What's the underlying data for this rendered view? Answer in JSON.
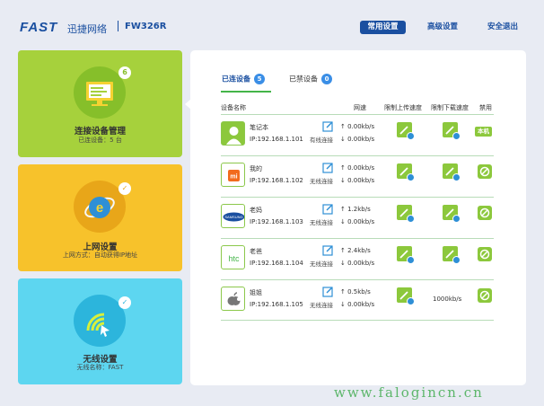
{
  "header": {
    "logo": "FAST",
    "brand": "迅捷网络",
    "model": "FW326R",
    "nav": [
      "常用设置",
      "高级设置",
      "安全退出"
    ]
  },
  "cards": [
    {
      "title": "连接设备管理",
      "sub": "已连设备：5 台",
      "badge": "6",
      "color": "#a6d13c",
      "icon": "monitor-icon"
    },
    {
      "title": "上网设置",
      "sub": "上网方式：自动获得IP地址",
      "badge": "✓",
      "color": "#f7c22b",
      "icon": "internet-explorer-icon"
    },
    {
      "title": "无线设置",
      "sub": "无线名称：FAST",
      "badge": "✓",
      "color": "#5dd6f0",
      "icon": "wifi-icon"
    }
  ],
  "tabs": {
    "connected_label": "已连设备",
    "connected_count": "5",
    "banned_label": "已禁设备",
    "banned_count": "0"
  },
  "table": {
    "headers": [
      "设备名称",
      "网速",
      "限制上传速度",
      "限制下载速度",
      "禁用"
    ],
    "rows": [
      {
        "name": "笔记本",
        "ip": "IP:192.168.1.101",
        "conn": "有线连接",
        "up": "↑ 0.00kb/s",
        "down": "↓ 0.00kb/s",
        "avatar": "person",
        "local": "本机"
      },
      {
        "name": "我的",
        "ip": "IP:192.168.1.102",
        "conn": "无线连接",
        "up": "↑ 0.00kb/s",
        "down": "↓ 0.00kb/s",
        "avatar": "mi"
      },
      {
        "name": "老妈",
        "ip": "IP:192.168.1.103",
        "conn": "无线连接",
        "up": "↑ 1.2kb/s",
        "down": "↓ 0.00kb/s",
        "avatar": "samsung"
      },
      {
        "name": "老爸",
        "ip": "IP:192.168.1.104",
        "conn": "无线连接",
        "up": "↑ 2.4kb/s",
        "down": "↓ 0.00kb/s",
        "avatar": "htc"
      },
      {
        "name": "姐姐",
        "ip": "IP:192.168.1.105",
        "conn": "无线连接",
        "up": "↑ 0.5kb/s",
        "down": "↓ 0.00kb/s",
        "avatar": "apple",
        "down_limit": "1000kb/s"
      }
    ]
  },
  "watermark": "www.falogincn.cn",
  "colors": {
    "brand_blue": "#1a4fa0",
    "accent_green": "#8cc83c",
    "badge_blue": "#3a8ee6"
  }
}
